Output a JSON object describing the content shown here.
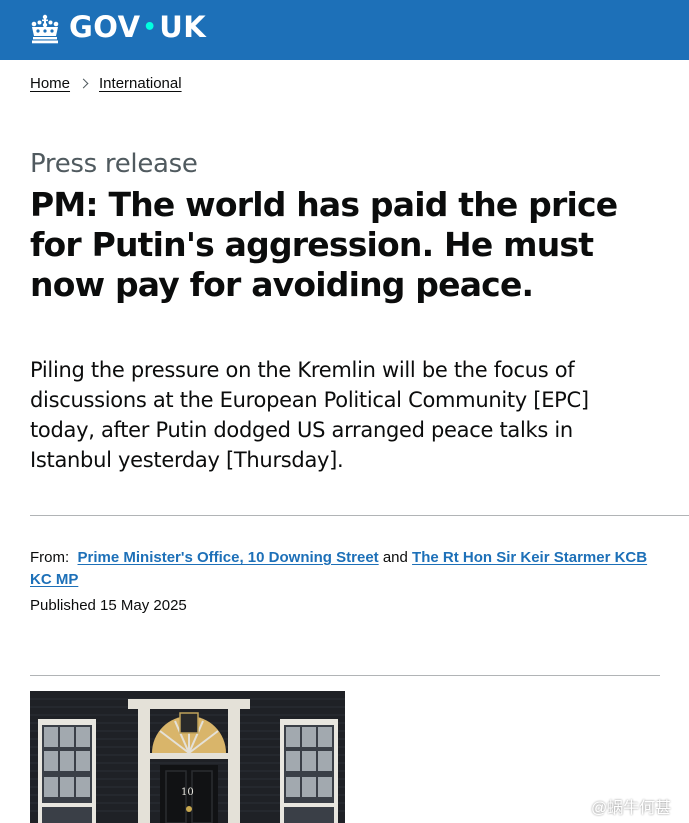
{
  "header": {
    "logo_text_left": "GOV",
    "logo_dot": "•",
    "logo_text_right": "UK"
  },
  "breadcrumbs": [
    {
      "label": "Home"
    },
    {
      "label": "International"
    }
  ],
  "article": {
    "caption": "Press release",
    "title": "PM: The world has paid the price for Putin's aggression. He must now pay for avoiding peace.",
    "lead": "Piling the pressure on the Kremlin will be the focus of discussions at the European Political Community [EPC] today, after Putin dodged US arranged peace talks in Istanbul yesterday [Thursday].",
    "from_label": "From:",
    "from_org_1": "Prime Minister's Office, 10 Downing Street",
    "from_and": "and",
    "from_org_2": "The Rt Hon Sir Keir Starmer KCB KC MP",
    "published": "Published 15 May 2025"
  },
  "image": {
    "subject": "10 Downing Street front door"
  },
  "watermark": {
    "text": "@蜗牛何甚"
  },
  "colors": {
    "brand": "#1d70b8",
    "text": "#0b0c0c",
    "secondary": "#505a5f",
    "link": "#1d70b8",
    "rule": "#b1b4b6"
  }
}
